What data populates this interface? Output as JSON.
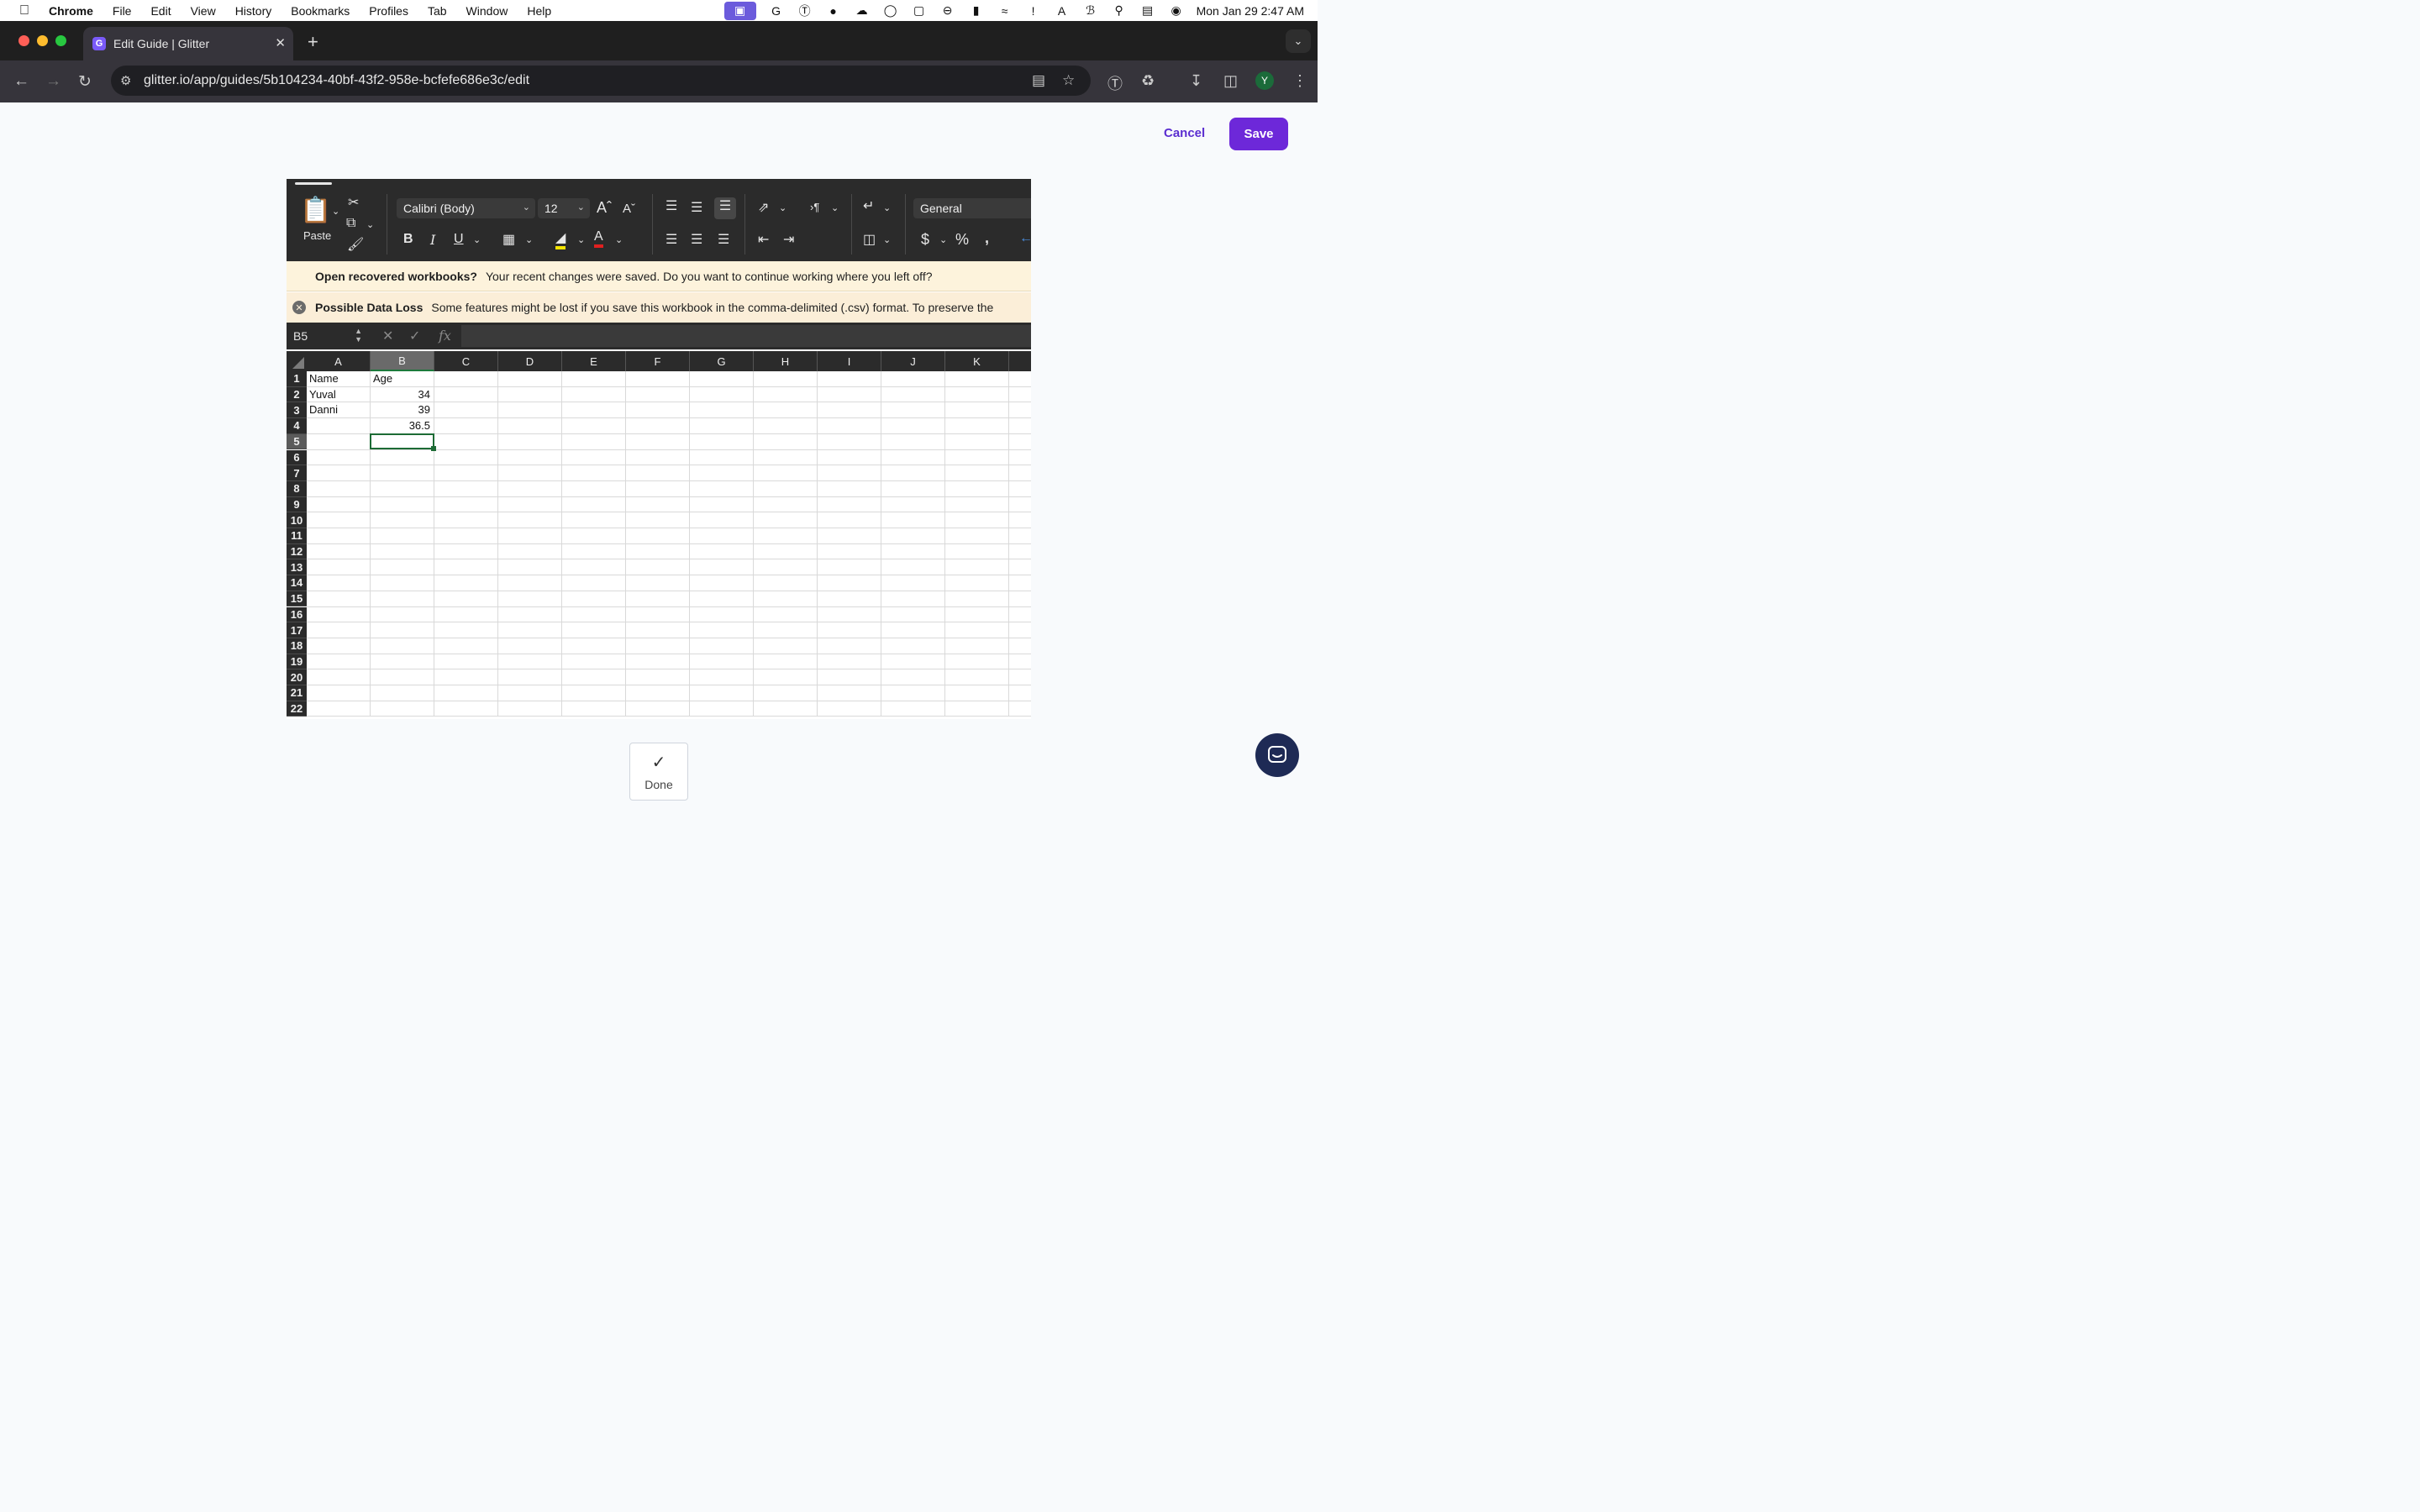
{
  "menubar": {
    "app_name": "Chrome",
    "items": [
      "File",
      "Edit",
      "View",
      "History",
      "Bookmarks",
      "Profiles",
      "Tab",
      "Window",
      "Help"
    ],
    "clock": "Mon Jan 29  2:47 AM"
  },
  "browser": {
    "tab_title": "Edit Guide | Glitter",
    "favicon_letter": "G",
    "url": "glitter.io/app/guides/5b104234-40bf-43f2-958e-bcfefe686e3c/edit",
    "profile_initial": "Y"
  },
  "page": {
    "cancel_label": "Cancel",
    "save_label": "Save",
    "done_label": "Done",
    "accent_color": "#6d28d9"
  },
  "excel": {
    "paste_label": "Paste",
    "font_name": "Calibri (Body)",
    "font_size": "12",
    "number_format": "General",
    "notice1_title": "Open recovered workbooks?",
    "notice1_text": "Your recent changes were saved. Do you want to continue working where you left off?",
    "notice2_title": "Possible Data Loss",
    "notice2_text": "Some features might be lost if you save this workbook in the comma-delimited (.csv) format. To preserve the",
    "name_box": "B5",
    "fx_label": "fx",
    "columns": [
      "A",
      "B",
      "C",
      "D",
      "E",
      "F",
      "G",
      "H",
      "I",
      "J",
      "K"
    ],
    "rows": [
      "1",
      "2",
      "3",
      "4",
      "5",
      "6",
      "7",
      "8",
      "9",
      "10",
      "11",
      "12",
      "13",
      "14",
      "15",
      "16",
      "17",
      "18",
      "19",
      "20",
      "21",
      "22"
    ],
    "cells": {
      "A1": "Name",
      "B1": "Age",
      "A2": "Yuval",
      "B2": "34",
      "A3": "Danni",
      "B3": "39",
      "B4": "36.5"
    },
    "selected_cell": "B5"
  }
}
